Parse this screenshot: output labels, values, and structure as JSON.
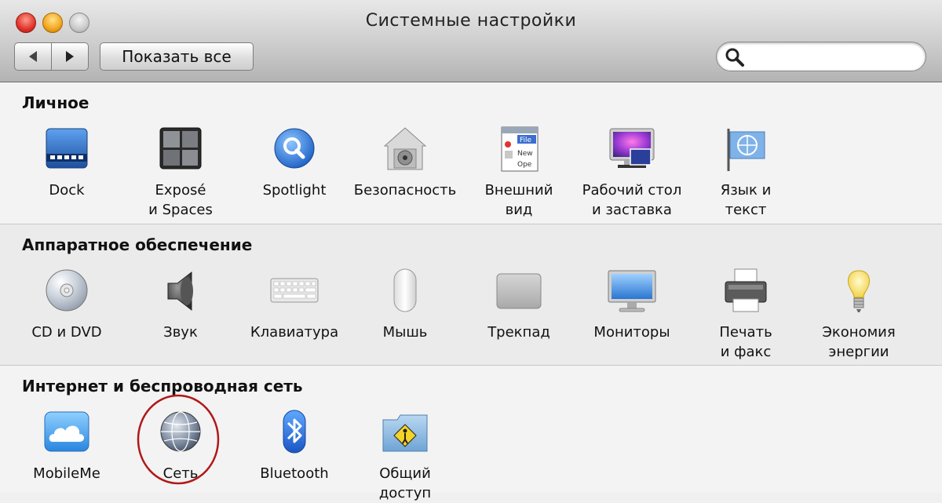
{
  "window": {
    "title": "Системные настройки"
  },
  "toolbar": {
    "show_all": "Показать все",
    "search_value": ""
  },
  "sections": {
    "personal": {
      "title": "Личное",
      "items": [
        {
          "label": "Dock",
          "icon": "dock-icon"
        },
        {
          "label": "Exposé\nи Spaces",
          "icon": "expose-spaces-icon"
        },
        {
          "label": "Spotlight",
          "icon": "spotlight-icon"
        },
        {
          "label": "Безопасность",
          "icon": "security-icon"
        },
        {
          "label": "Внешний\nвид",
          "icon": "appearance-icon"
        },
        {
          "label": "Рабочий стол\nи заставка",
          "icon": "desktop-screensaver-icon"
        },
        {
          "label": "Язык и\nтекст",
          "icon": "language-text-icon"
        }
      ]
    },
    "hardware": {
      "title": "Аппаратное обеспечение",
      "items": [
        {
          "label": "CD и DVD",
          "icon": "cd-dvd-icon"
        },
        {
          "label": "Звук",
          "icon": "sound-icon"
        },
        {
          "label": "Клавиатура",
          "icon": "keyboard-icon"
        },
        {
          "label": "Мышь",
          "icon": "mouse-icon"
        },
        {
          "label": "Трекпад",
          "icon": "trackpad-icon"
        },
        {
          "label": "Мониторы",
          "icon": "displays-icon"
        },
        {
          "label": "Печать\nи факс",
          "icon": "print-fax-icon"
        },
        {
          "label": "Экономия\nэнергии",
          "icon": "energy-saver-icon"
        }
      ]
    },
    "internet": {
      "title": "Интернет и беспроводная сеть",
      "items": [
        {
          "label": "MobileMe",
          "icon": "mobileme-icon"
        },
        {
          "label": "Сеть",
          "icon": "network-icon",
          "highlighted": true
        },
        {
          "label": "Bluetooth",
          "icon": "bluetooth-icon"
        },
        {
          "label": "Общий\nдоступ",
          "icon": "sharing-icon"
        }
      ]
    }
  },
  "colors": {
    "highlight_circle": "#b01818",
    "accent_blue": "#2a6fd6"
  }
}
